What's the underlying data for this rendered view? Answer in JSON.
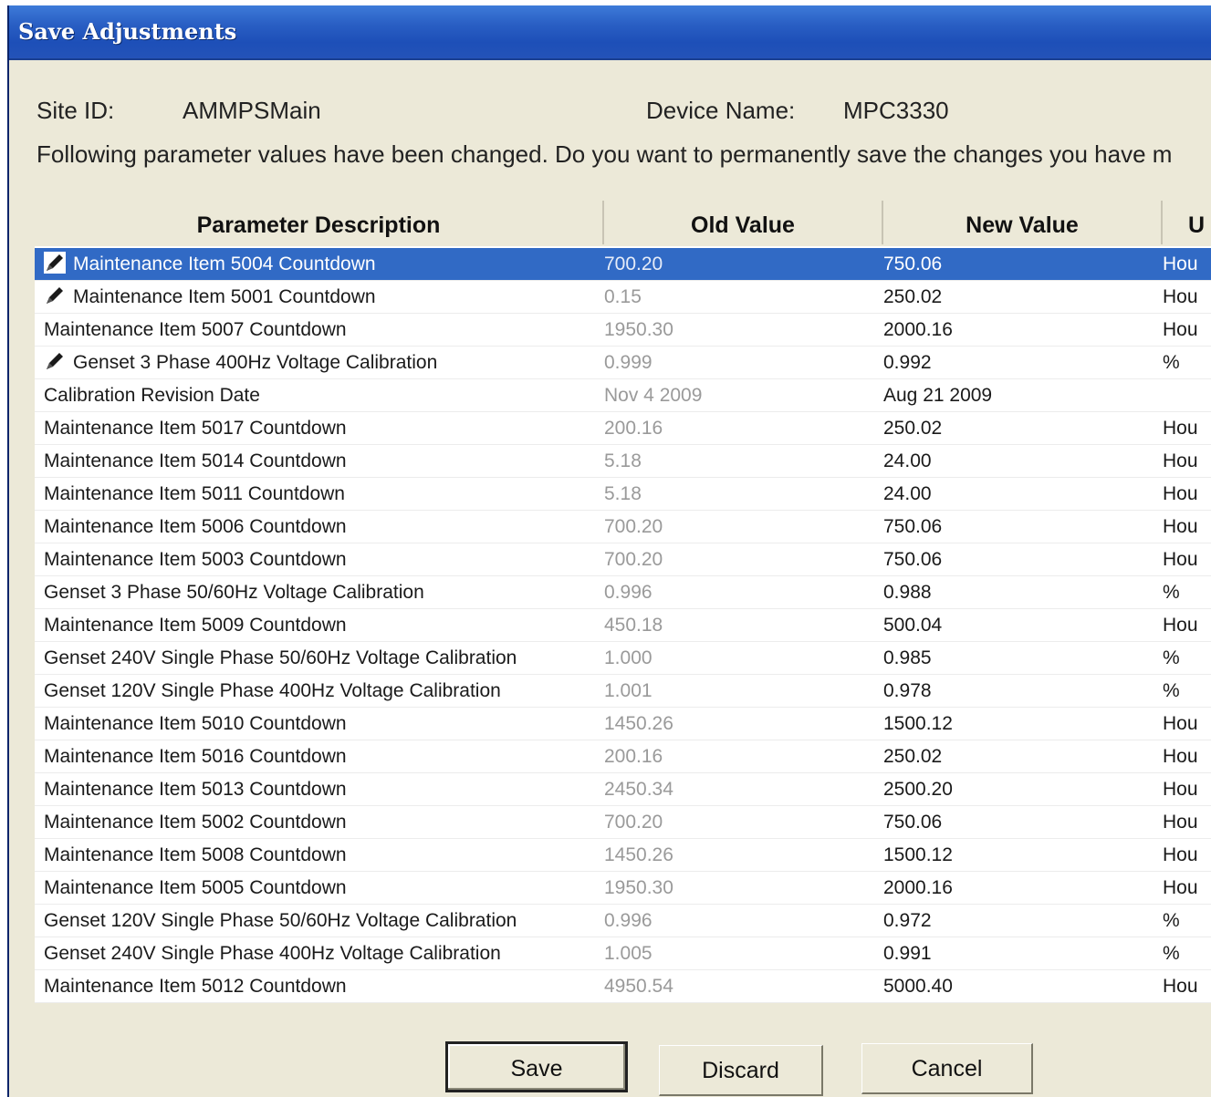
{
  "window": {
    "title": "Save Adjustments"
  },
  "site": {
    "label": "Site ID:",
    "value": "AMMPSMain"
  },
  "device": {
    "label": "Device Name:",
    "value": "MPC3330"
  },
  "message": "Following parameter values have been changed. Do you want to permanently save the changes you have m",
  "table": {
    "columns": [
      "Parameter Description",
      "Old Value",
      "New Value",
      "U"
    ],
    "selected_row": 0,
    "rows": [
      {
        "edited": true,
        "desc": "Maintenance Item 5004 Countdown",
        "old": "700.20",
        "new": "750.06",
        "unit": "Hou"
      },
      {
        "edited": true,
        "desc": "Maintenance Item 5001 Countdown",
        "old": "0.15",
        "new": "250.02",
        "unit": "Hou"
      },
      {
        "edited": false,
        "desc": "Maintenance Item 5007 Countdown",
        "old": "1950.30",
        "new": "2000.16",
        "unit": "Hou"
      },
      {
        "edited": true,
        "desc": "Genset 3 Phase 400Hz Voltage Calibration",
        "old": "0.999",
        "new": "0.992",
        "unit": "%"
      },
      {
        "edited": false,
        "desc": "Calibration Revision Date",
        "old": "Nov  4 2009",
        "new": "Aug 21 2009",
        "unit": ""
      },
      {
        "edited": false,
        "desc": "Maintenance Item 5017 Countdown",
        "old": "200.16",
        "new": "250.02",
        "unit": "Hou"
      },
      {
        "edited": false,
        "desc": "Maintenance Item 5014 Countdown",
        "old": "5.18",
        "new": "24.00",
        "unit": "Hou"
      },
      {
        "edited": false,
        "desc": "Maintenance Item 5011 Countdown",
        "old": "5.18",
        "new": "24.00",
        "unit": "Hou"
      },
      {
        "edited": false,
        "desc": "Maintenance Item 5006 Countdown",
        "old": "700.20",
        "new": "750.06",
        "unit": "Hou"
      },
      {
        "edited": false,
        "desc": "Maintenance Item 5003 Countdown",
        "old": "700.20",
        "new": "750.06",
        "unit": "Hou"
      },
      {
        "edited": false,
        "desc": "Genset 3 Phase 50/60Hz Voltage Calibration",
        "old": "0.996",
        "new": "0.988",
        "unit": "%"
      },
      {
        "edited": false,
        "desc": "Maintenance Item 5009 Countdown",
        "old": "450.18",
        "new": "500.04",
        "unit": "Hou"
      },
      {
        "edited": false,
        "desc": "Genset 240V Single Phase 50/60Hz Voltage Calibration",
        "old": "1.000",
        "new": "0.985",
        "unit": "%"
      },
      {
        "edited": false,
        "desc": "Genset 120V Single Phase 400Hz Voltage Calibration",
        "old": "1.001",
        "new": "0.978",
        "unit": "%"
      },
      {
        "edited": false,
        "desc": "Maintenance Item 5010 Countdown",
        "old": "1450.26",
        "new": "1500.12",
        "unit": "Hou"
      },
      {
        "edited": false,
        "desc": "Maintenance Item 5016 Countdown",
        "old": "200.16",
        "new": "250.02",
        "unit": "Hou"
      },
      {
        "edited": false,
        "desc": "Maintenance Item 5013 Countdown",
        "old": "2450.34",
        "new": "2500.20",
        "unit": "Hou"
      },
      {
        "edited": false,
        "desc": "Maintenance Item 5002 Countdown",
        "old": "700.20",
        "new": "750.06",
        "unit": "Hou"
      },
      {
        "edited": false,
        "desc": "Maintenance Item 5008 Countdown",
        "old": "1450.26",
        "new": "1500.12",
        "unit": "Hou"
      },
      {
        "edited": false,
        "desc": "Maintenance Item 5005 Countdown",
        "old": "1950.30",
        "new": "2000.16",
        "unit": "Hou"
      },
      {
        "edited": false,
        "desc": "Genset 120V Single Phase 50/60Hz Voltage Calibration",
        "old": "0.996",
        "new": "0.972",
        "unit": "%"
      },
      {
        "edited": false,
        "desc": "Genset 240V Single Phase 400Hz Voltage Calibration",
        "old": "1.005",
        "new": "0.991",
        "unit": "%"
      },
      {
        "edited": false,
        "desc": "Maintenance Item 5012 Countdown",
        "old": "4950.54",
        "new": "5000.40",
        "unit": "Hou"
      }
    ]
  },
  "buttons": {
    "save": "Save",
    "discard": "Discard",
    "cancel": "Cancel"
  },
  "icons": {
    "edited_marker": "pencil-icon"
  },
  "colors": {
    "title_bar": "#2a5fc4",
    "selection": "#316ac5",
    "dialog_bg": "#ece9d8"
  }
}
